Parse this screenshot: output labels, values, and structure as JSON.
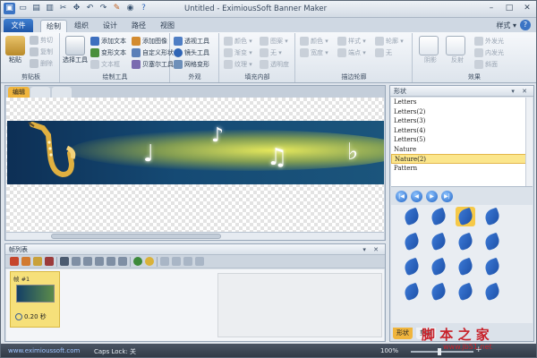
{
  "window": {
    "title": "Untitled - EximiousSoft Banner Maker",
    "controls": {
      "minimize": "–",
      "maximize": "□",
      "close": "✕"
    }
  },
  "ribbon": {
    "file_tab": "文件",
    "tabs": [
      "绘制",
      "组织",
      "设计",
      "路径",
      "视图"
    ],
    "style_menu": "样式 ▾",
    "groups": {
      "clipboard": {
        "label": "剪贴板",
        "paste": "粘贴",
        "cut": "剪切",
        "copy": "复制",
        "delete": "删除"
      },
      "draw_tools": {
        "label": "绘制工具",
        "select_tool": "选择工具",
        "add_text": "添加文本",
        "add_image": "添加图像",
        "path_text": "变形文本",
        "custom_shape": "自定义形状",
        "text_box": "文本框",
        "bezier_tool": "贝塞尔工具"
      },
      "shape": {
        "label": "外观",
        "transparency": "透视工具",
        "lens_tool": "镜头工具",
        "grid_shape": "网格变形"
      },
      "fill": {
        "label": "填充内部",
        "items": [
          "颜色 ▾",
          "渐变 ▾",
          "纹理 ▾",
          "图案 ▾",
          "无 ▾",
          "透明度"
        ]
      },
      "outline": {
        "label": "描边轮廓",
        "items": [
          "颜色 ▾",
          "宽度 ▾",
          "样式 ▾",
          "端点 ▾",
          "轮廓 ▾",
          "无"
        ]
      },
      "effects": {
        "label": "效果",
        "items": [
          "阴影",
          "反射",
          "外发光",
          "内发光",
          "斜面"
        ]
      }
    }
  },
  "editor": {
    "tabs": [
      "编辑",
      "",
      ""
    ]
  },
  "frames_panel": {
    "title": "帧列表",
    "header_buttons": "▾ ✕",
    "frame": {
      "label": "帧 #1",
      "duration": "0.20 秒"
    }
  },
  "shape_panel": {
    "title": "形状",
    "header_buttons": "▾ ✕",
    "items": [
      "Letters",
      "Letters(2)",
      "Letters(3)",
      "Letters(4)",
      "Letters(5)",
      "Nature",
      "Nature(2)",
      "Pattern"
    ],
    "selected_index": 6,
    "nav": [
      "|◀",
      "◀",
      "▶",
      "▶|"
    ],
    "bottom_tabs": [
      "形状",
      "剪贴"
    ]
  },
  "statusbar": {
    "url": "www.eximioussoft.com",
    "caps_lock": "Caps Lock: 关",
    "zoom": "100%",
    "zoom_level": 0.45,
    "zoom_plus": "+"
  },
  "watermark": {
    "line1": "脚 本 之 家",
    "line2": "www.jb51.net"
  },
  "colors": {
    "accent": "#f0b53d",
    "file_tab": "#1e56a8",
    "banner_bg": "#154a74",
    "status_bg": "#2f3844",
    "selected_item": "#fbe68c",
    "shape_blue": "#2b63bf"
  }
}
